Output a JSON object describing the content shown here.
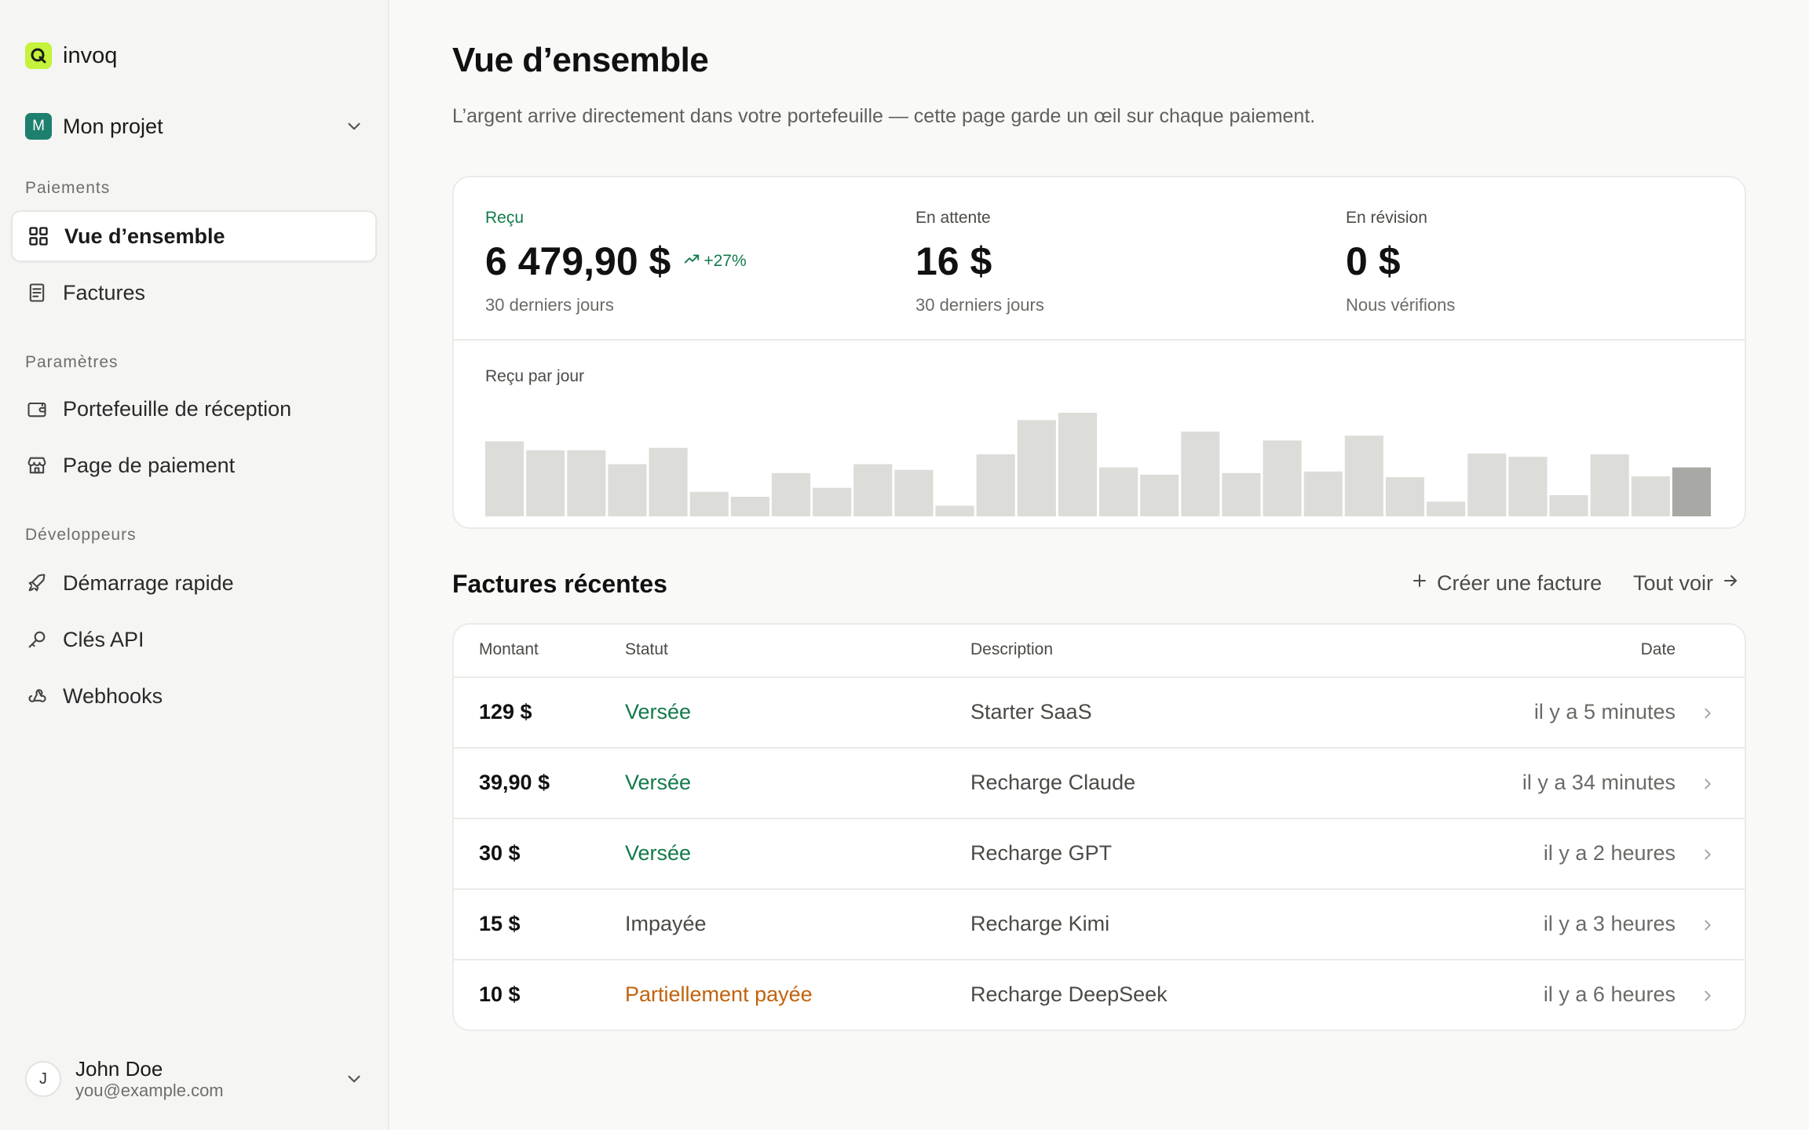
{
  "brand": {
    "name": "invoq",
    "accent": "#c5f23a"
  },
  "project": {
    "initial": "M",
    "name": "Mon projet"
  },
  "sidebar": {
    "sections": [
      {
        "label": "Paiements"
      },
      {
        "label": "Paramètres"
      },
      {
        "label": "Développeurs"
      }
    ],
    "items": [
      {
        "label": "Vue d’ensemble",
        "icon": "grid-icon",
        "active": true
      },
      {
        "label": "Factures",
        "icon": "receipt-icon"
      },
      {
        "label": "Portefeuille de réception",
        "icon": "wallet-icon"
      },
      {
        "label": "Page de paiement",
        "icon": "store-icon"
      },
      {
        "label": "Démarrage rapide",
        "icon": "rocket-icon"
      },
      {
        "label": "Clés API",
        "icon": "key-icon"
      },
      {
        "label": "Webhooks",
        "icon": "webhook-icon"
      }
    ]
  },
  "user": {
    "initial": "J",
    "name": "John Doe",
    "email": "you@example.com"
  },
  "page": {
    "title": "Vue d’ensemble",
    "subtitle": "L’argent arrive directement dans votre portefeuille — cette page garde un œil sur chaque paiement."
  },
  "stats": {
    "received": {
      "label": "Reçu",
      "value": "6 479,90 $",
      "trend": "+27%",
      "period": "30 derniers jours"
    },
    "pending": {
      "label": "En attente",
      "value": "16 $",
      "period": "30 derniers jours"
    },
    "review": {
      "label": "En révision",
      "value": "0 $",
      "period": "Nous vérifions"
    }
  },
  "chart_data": {
    "type": "bar",
    "title": "Reçu par jour",
    "values": [
      92,
      81,
      81,
      64,
      84,
      30,
      24,
      53,
      35,
      64,
      57,
      13,
      76,
      118,
      127,
      60,
      51,
      104,
      53,
      93,
      55,
      99,
      48,
      18,
      77,
      73,
      26,
      76,
      49,
      60
    ],
    "highlight_last": true,
    "colors": {
      "bar": "#dcdcd8",
      "last": "#a8a8a4"
    },
    "grid": false
  },
  "recent": {
    "title": "Factures récentes",
    "create_label": "Créer une facture",
    "see_all_label": "Tout voir",
    "columns": {
      "amount": "Montant",
      "status": "Statut",
      "description": "Description",
      "date": "Date"
    },
    "rows": [
      {
        "amount": "129 $",
        "status": "Versée",
        "status_kind": "paid",
        "description": "Starter SaaS",
        "date": "il y a 5 minutes"
      },
      {
        "amount": "39,90 $",
        "status": "Versée",
        "status_kind": "paid",
        "description": "Recharge Claude",
        "date": "il y a 34 minutes"
      },
      {
        "amount": "30 $",
        "status": "Versée",
        "status_kind": "paid",
        "description": "Recharge GPT",
        "date": "il y a 2 heures"
      },
      {
        "amount": "15 $",
        "status": "Impayée",
        "status_kind": "unpaid",
        "description": "Recharge Kimi",
        "date": "il y a 3 heures"
      },
      {
        "amount": "10 $",
        "status": "Partiellement payée",
        "status_kind": "partial",
        "description": "Recharge DeepSeek",
        "date": "il y a 6 heures"
      }
    ]
  },
  "colors": {
    "paid": "#137a4a",
    "partial": "#c2620c",
    "project": "#1d7f6e"
  }
}
